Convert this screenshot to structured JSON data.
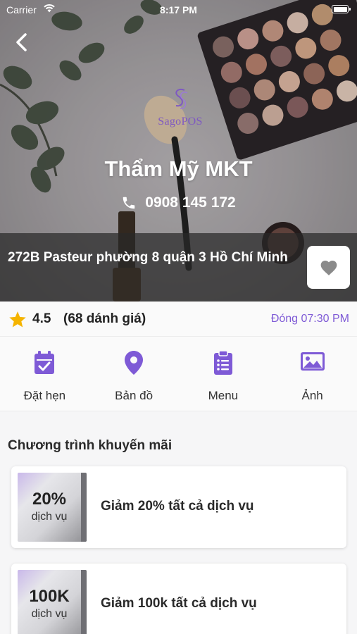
{
  "status_bar": {
    "carrier": "Carrier",
    "time": "8:17 PM"
  },
  "store": {
    "logo_text": "SagoPOS",
    "name": "Thẩm Mỹ MKT",
    "phone": "0908 145 172",
    "address": "272B Pasteur phường 8 quận 3 Hồ Chí Minh"
  },
  "rating": {
    "value": "4.5",
    "count_text": "(68 dánh giá)",
    "closing_text": "Đóng 07:30 PM"
  },
  "actions": [
    {
      "label": "Đặt hẹn",
      "icon": "calendar-check-icon"
    },
    {
      "label": "Bản đồ",
      "icon": "map-pin-icon"
    },
    {
      "label": "Menu",
      "icon": "clipboard-list-icon"
    },
    {
      "label": "Ảnh",
      "icon": "image-icon"
    }
  ],
  "promotions": {
    "title": "Chương trình khuyến mãi",
    "items": [
      {
        "badge_value": "20%",
        "badge_sub": "dịch vụ",
        "text": "Giảm 20% tất cả dịch vụ"
      },
      {
        "badge_value": "100K",
        "badge_sub": "dịch vụ",
        "text": "Giảm 100k tất cả dịch vụ"
      }
    ]
  },
  "colors": {
    "accent": "#7e5ad6",
    "star": "#f5b400",
    "address_bar": "#2a2a2a"
  }
}
